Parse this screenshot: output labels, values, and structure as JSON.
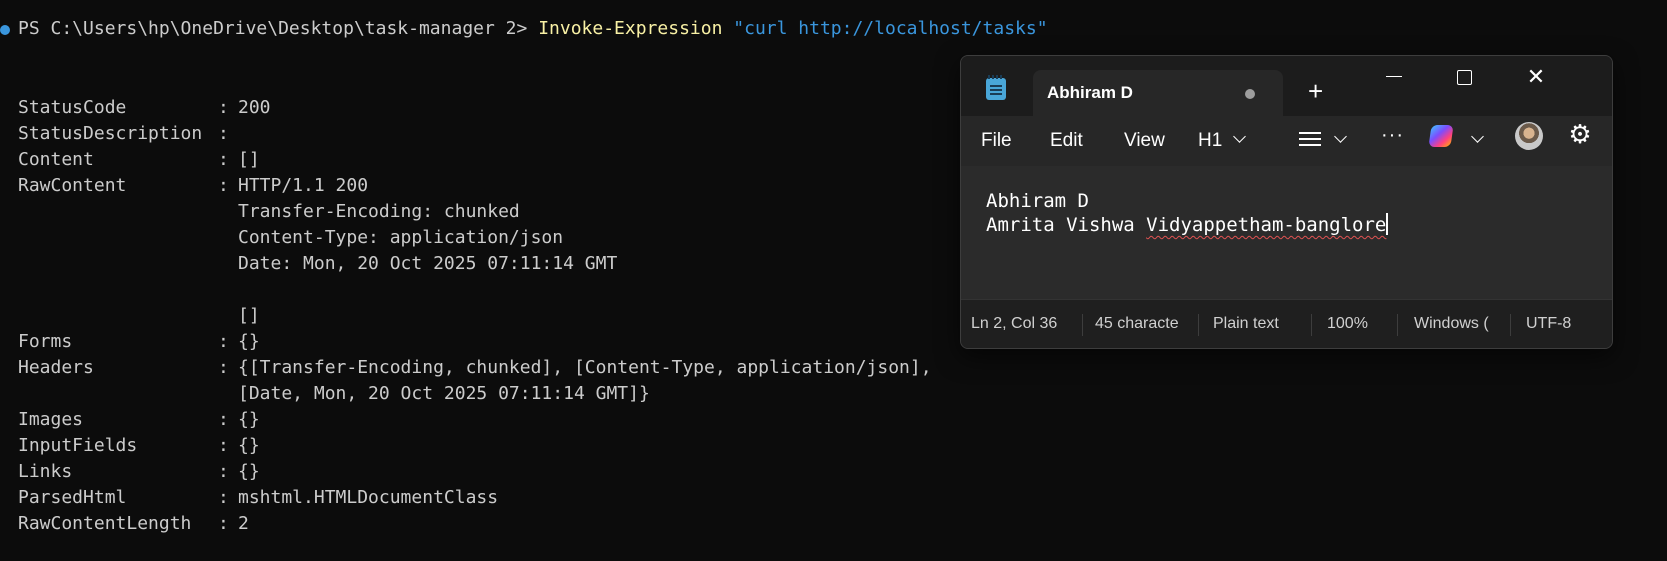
{
  "terminal": {
    "prompt": "PS C:\\Users\\hp\\OneDrive\\Desktop\\task-manager 2>",
    "command": "Invoke-Expression",
    "argument": "\"curl http://localhost/tasks\"",
    "rows": [
      {
        "key": "StatusCode",
        "sep": ":",
        "value": "200"
      },
      {
        "key": "StatusDescription",
        "sep": ":",
        "value": ""
      },
      {
        "key": "Content",
        "sep": ":",
        "value": "[]"
      },
      {
        "key": "RawContent",
        "sep": ":",
        "value": "HTTP/1.1 200"
      },
      {
        "key": "",
        "sep": "",
        "value": "Transfer-Encoding: chunked"
      },
      {
        "key": "",
        "sep": "",
        "value": "Content-Type: application/json"
      },
      {
        "key": "",
        "sep": "",
        "value": "Date: Mon, 20 Oct 2025 07:11:14 GMT"
      },
      {
        "key": "",
        "sep": "",
        "value": ""
      },
      {
        "key": "",
        "sep": "",
        "value": "[]"
      },
      {
        "key": "Forms",
        "sep": ":",
        "value": "{}"
      },
      {
        "key": "Headers",
        "sep": ":",
        "value": "{[Transfer-Encoding, chunked], [Content-Type, application/json],"
      },
      {
        "key": "",
        "sep": "",
        "value": "[Date, Mon, 20 Oct 2025 07:11:14 GMT]}"
      },
      {
        "key": "Images",
        "sep": ":",
        "value": "{}"
      },
      {
        "key": "InputFields",
        "sep": ":",
        "value": "{}"
      },
      {
        "key": "Links",
        "sep": ":",
        "value": "{}"
      },
      {
        "key": "ParsedHtml",
        "sep": ":",
        "value": "mshtml.HTMLDocumentClass"
      },
      {
        "key": "RawContentLength",
        "sep": ":",
        "value": "2"
      }
    ]
  },
  "notepad": {
    "tab_title": "Abhiram D",
    "new_tab_symbol": "+",
    "close_symbol": "✕",
    "menu": {
      "file": "File",
      "edit": "Edit",
      "view": "View",
      "heading": "H1",
      "more": "···"
    },
    "content": {
      "line1": "Abhiram D",
      "line2_prefix": "Amrita Vishwa ",
      "line2_misspelled": "Vidyappetham-banglore"
    },
    "status": {
      "position": "Ln 2, Col 36",
      "characters": "45 characte",
      "format": "Plain text",
      "zoom": "100%",
      "line_ending": "Windows (",
      "encoding": "UTF-8"
    },
    "icons": {
      "app": "notepad-icon",
      "list": "list-icon",
      "copilot": "copilot-icon",
      "avatar": "avatar",
      "settings": "gear-icon"
    }
  }
}
